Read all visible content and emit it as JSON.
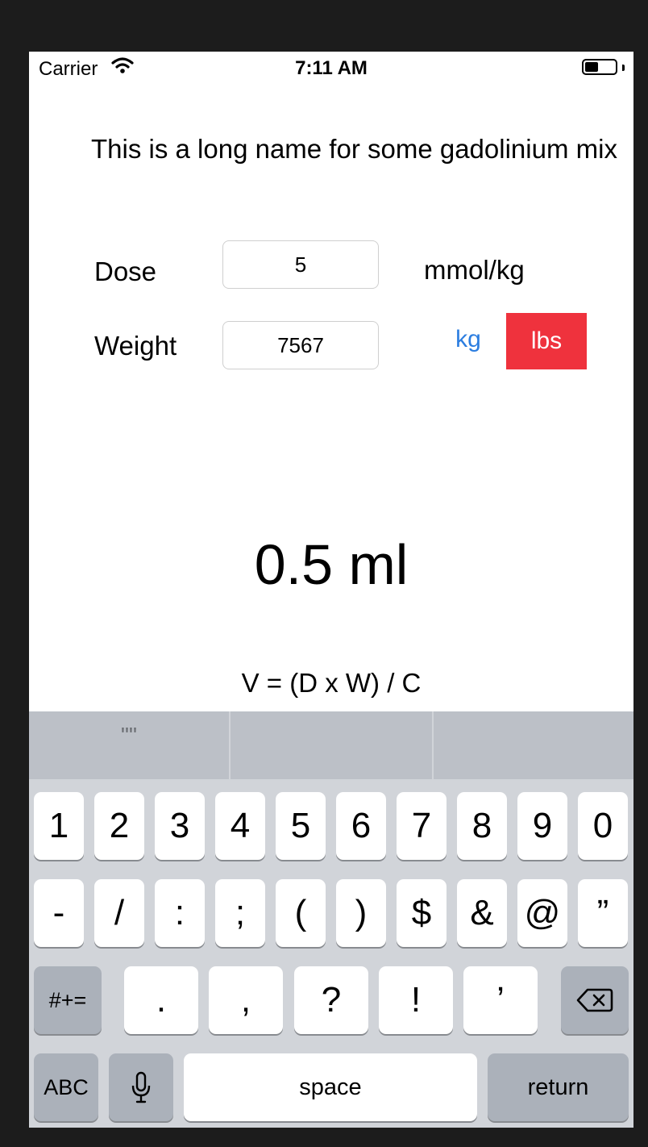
{
  "status": {
    "carrier": "Carrier",
    "time": "7:11 AM"
  },
  "title": "This is a long name for some gadolinium mix",
  "dose": {
    "label": "Dose",
    "value": "5",
    "unit": "mmol/kg"
  },
  "weight": {
    "label": "Weight",
    "value": "7567",
    "unit_kg": "kg",
    "unit_lbs": "lbs",
    "selected_unit": "lbs"
  },
  "result": "0.5 ml",
  "formula": "V = (D x W) / C",
  "keyboard": {
    "suggestion": "\"\"",
    "row1": [
      "1",
      "2",
      "3",
      "4",
      "5",
      "6",
      "7",
      "8",
      "9",
      "0"
    ],
    "row2": [
      "-",
      "/",
      ":",
      ";",
      "(",
      ")",
      "$",
      "&",
      "@",
      "”"
    ],
    "row3": {
      "toggle": "#+=",
      "keys": [
        ".",
        ",",
        "?",
        "!",
        "’"
      ]
    },
    "row4": {
      "abc": "ABC",
      "space": "space",
      "return": "return"
    }
  },
  "colors": {
    "accent": "#2b7de0",
    "selected": "#ef323d"
  }
}
